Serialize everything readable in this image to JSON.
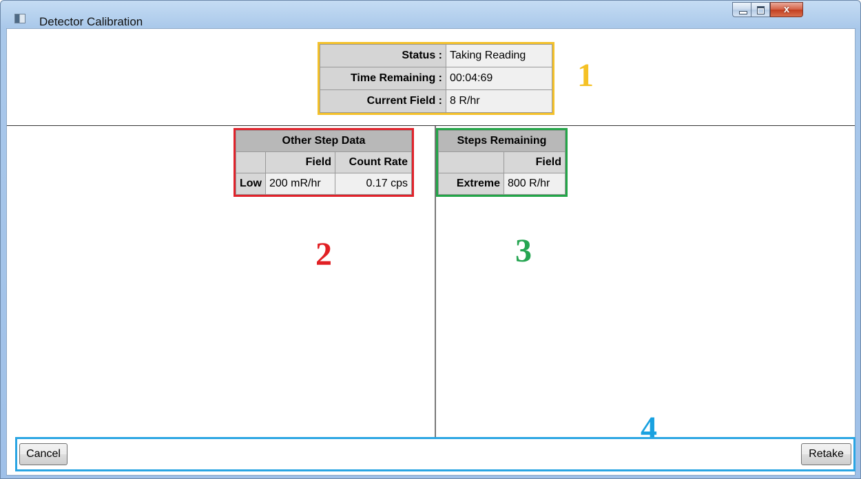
{
  "window": {
    "title": "Detector Calibration",
    "close_glyph": "x"
  },
  "status_panel": {
    "status_label": "Status :",
    "status_value": "Taking Reading",
    "time_label": "Time Remaining :",
    "time_value": "00:04:69",
    "field_label": "Current Field :",
    "field_value": "8 R/hr"
  },
  "other_step_data": {
    "title": "Other Step Data",
    "col_field": "Field",
    "col_count_rate": "Count Rate",
    "rows": [
      {
        "step": "Low",
        "field": "200 mR/hr",
        "count_rate": "0.17 cps"
      }
    ]
  },
  "steps_remaining": {
    "title": "Steps Remaining",
    "col_field": "Field",
    "rows": [
      {
        "step": "Extreme",
        "field": "800 R/hr"
      }
    ]
  },
  "markers": {
    "m1": "1",
    "m2": "2",
    "m3": "3",
    "m4": "4"
  },
  "marker_colors": {
    "m1": "#f5c125",
    "m2": "#e12024",
    "m3": "#26a552",
    "m4": "#19a1e0"
  },
  "buttons": {
    "cancel": "Cancel",
    "retake": "Retake"
  }
}
